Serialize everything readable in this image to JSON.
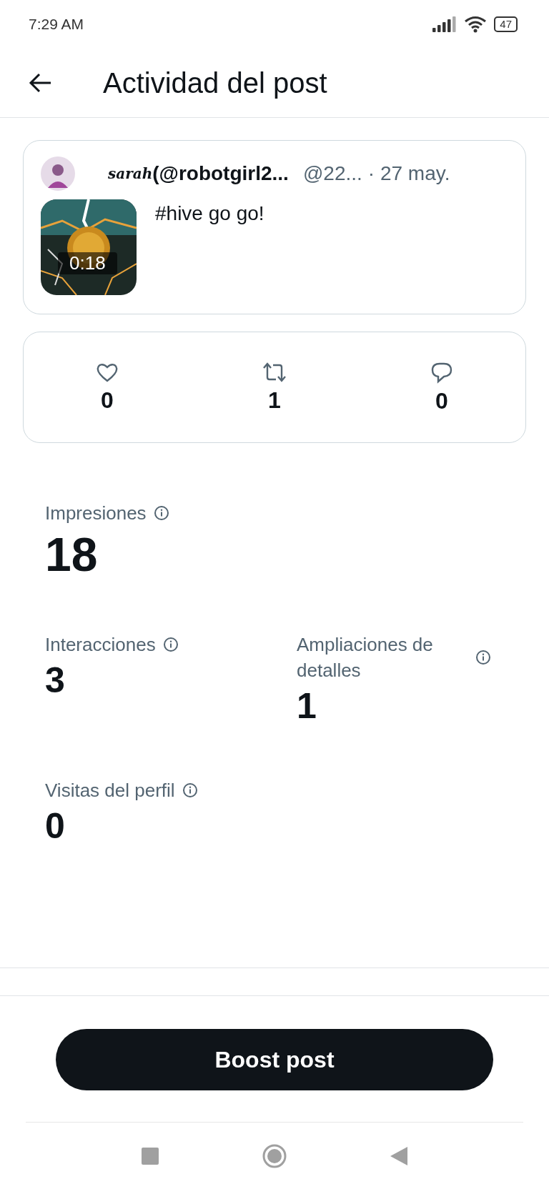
{
  "status_bar": {
    "time": "7:29 AM",
    "battery": "47"
  },
  "header": {
    "title": "Actividad del post"
  },
  "post": {
    "display_name": "sarah",
    "handle": "(@robotgirl2...",
    "username": "@22...",
    "date": "· 27 may.",
    "text": "#hive go go!",
    "media": {
      "kind": "picture",
      "duration": "0:18"
    }
  },
  "engagement": [
    {
      "kind": "like",
      "count": "0"
    },
    {
      "kind": "repost",
      "count": "1"
    },
    {
      "kind": "reply",
      "count": "0"
    }
  ],
  "metrics": [
    {
      "label": "Impresiones",
      "value": "18",
      "kind": "headline"
    },
    {
      "label": "Interacciones",
      "value": "3",
      "kind": "standard"
    },
    {
      "label": "Ampliaciones de detalles",
      "value": "1",
      "kind": "standard"
    },
    {
      "label": "Visitas del perfil",
      "value": "0",
      "kind": "standard"
    }
  ],
  "action": {
    "label": "Boost post"
  }
}
